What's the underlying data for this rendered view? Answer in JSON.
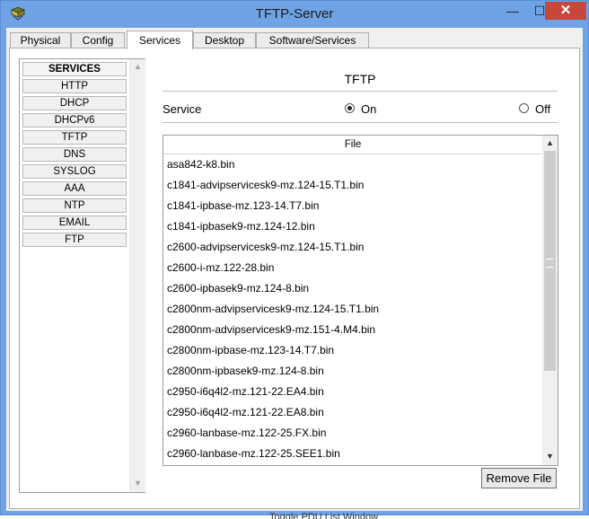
{
  "window": {
    "title": "TFTP-Server"
  },
  "controls": {
    "minimize": "—",
    "maximize": "☐",
    "close": "✕"
  },
  "tabs": [
    {
      "label": "Physical"
    },
    {
      "label": "Config"
    },
    {
      "label": "Services",
      "active": true
    },
    {
      "label": "Desktop"
    },
    {
      "label": "Software/Services"
    }
  ],
  "services": {
    "header": "SERVICES",
    "items": [
      "HTTP",
      "DHCP",
      "DHCPv6",
      "TFTP",
      "DNS",
      "SYSLOG",
      "AAA",
      "NTP",
      "EMAIL",
      "FTP"
    ]
  },
  "tftp": {
    "title": "TFTP",
    "service_label": "Service",
    "on_label": "On",
    "off_label": "Off",
    "selected": "On",
    "file_column": "File",
    "files": [
      "asa842-k8.bin",
      "c1841-advipservicesk9-mz.124-15.T1.bin",
      "c1841-ipbase-mz.123-14.T7.bin",
      "c1841-ipbasek9-mz.124-12.bin",
      "c2600-advipservicesk9-mz.124-15.T1.bin",
      "c2600-i-mz.122-28.bin",
      "c2600-ipbasek9-mz.124-8.bin",
      "c2800nm-advipservicesk9-mz.124-15.T1.bin",
      "c2800nm-advipservicesk9-mz.151-4.M4.bin",
      "c2800nm-ipbase-mz.123-14.T7.bin",
      "c2800nm-ipbasek9-mz.124-8.bin",
      "c2950-i6q4l2-mz.121-22.EA4.bin",
      "c2950-i6q4l2-mz.121-22.EA8.bin",
      "c2960-lanbase-mz.122-25.FX.bin",
      "c2960-lanbase-mz.122-25.SEE1.bin"
    ],
    "remove_button": "Remove File"
  },
  "background_window_text": "Toggle PDU List Window"
}
